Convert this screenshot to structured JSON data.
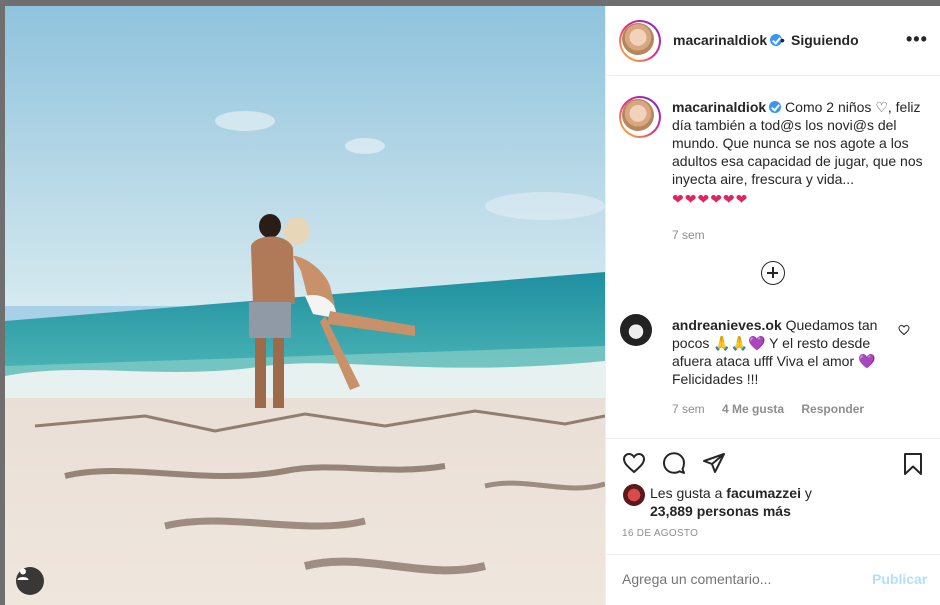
{
  "post": {
    "username": "macarinaldiok",
    "follow_status": "Siguiendo",
    "more_icon": "more-icon"
  },
  "caption": {
    "username": "macarinaldiok",
    "text": "Como 2 niños ♡, feliz día también a tod@s los novi@s del mundo. Que nunca se nos agote a los adultos esa capacidad de jugar, que nos inyecta aire, frescura y vida...",
    "hearts": "❤❤❤❤❤❤",
    "time": "7 sem"
  },
  "comment": {
    "username": "andreanieves.ok",
    "text": "Quedamos tan pocos 🙏🙏💜 Y el resto desde afuera ataca ufff Viva el amor 💜 Felicidades !!!",
    "time": "7 sem",
    "likes": "4 Me gusta",
    "reply": "Responder"
  },
  "likes": {
    "prefix": "Les gusta a",
    "user": "facumazzei",
    "conj": "y",
    "count": "23,889 personas más"
  },
  "date": "16 DE AGOSTO",
  "add_comment": {
    "placeholder": "Agrega un comentario...",
    "publish": "Publicar"
  },
  "colors": {
    "verified": "#3897f0",
    "heart": "#e0245e",
    "publish_disabled": "#b2dffc"
  }
}
